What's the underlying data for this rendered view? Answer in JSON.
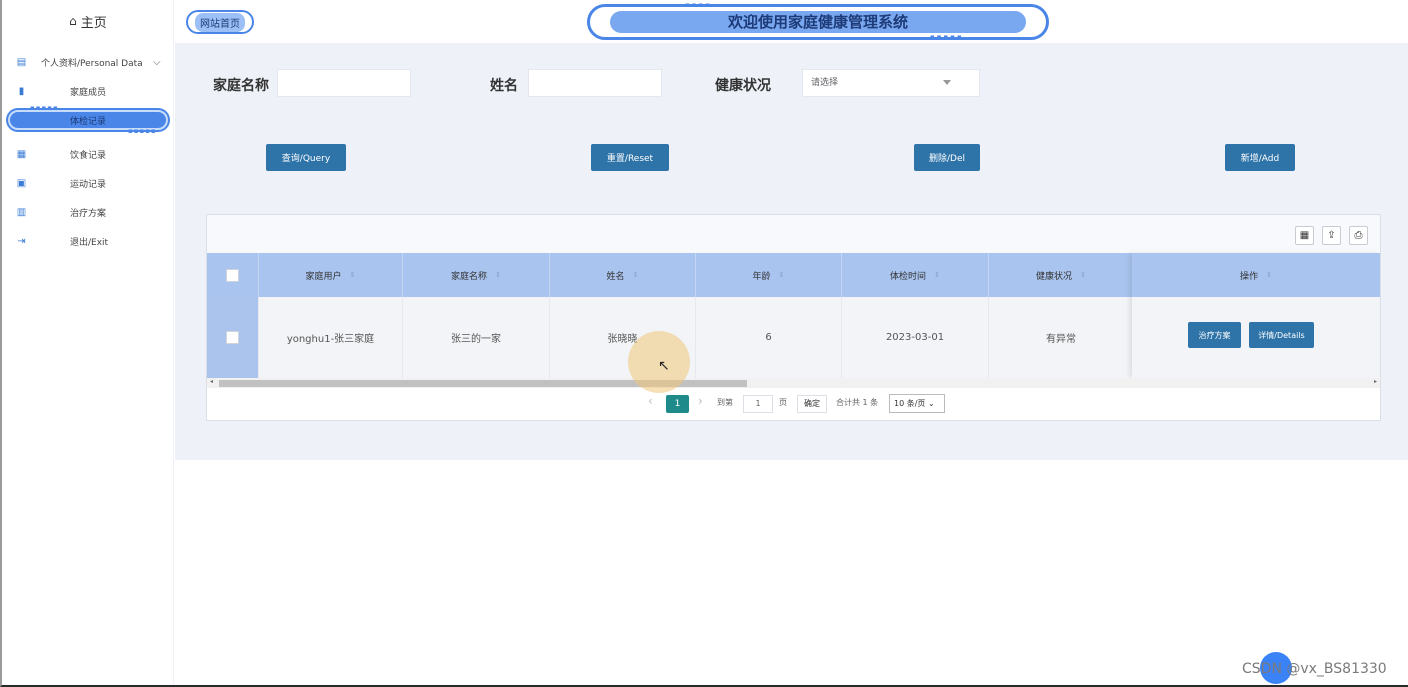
{
  "sidebar": {
    "home": "主页",
    "group": "个人资料/Personal Data",
    "items": [
      {
        "label": "家庭成员",
        "icon": "bookmark-icon"
      },
      {
        "label": "体检记录",
        "icon": "document-icon"
      },
      {
        "label": "饮食记录",
        "icon": "calendar-icon"
      },
      {
        "label": "运动记录",
        "icon": "calendar-check-icon"
      },
      {
        "label": "治疗方案",
        "icon": "book-icon"
      },
      {
        "label": "退出/Exit",
        "icon": "logout-icon"
      }
    ]
  },
  "header": {
    "home_link": "网站首页",
    "title": "欢迎使用家庭健康管理系统"
  },
  "search": {
    "family_name_label": "家庭名称",
    "family_name_value": "",
    "name_label": "姓名",
    "name_value": "",
    "health_label": "健康状况",
    "health_placeholder": "请选择"
  },
  "actions": {
    "query": "查询/Query",
    "reset": "重置/Reset",
    "delete": "删除/Del",
    "add": "新增/Add"
  },
  "table": {
    "columns": [
      "家庭用户",
      "家庭名称",
      "姓名",
      "年龄",
      "体检时间",
      "健康状况",
      "操作"
    ],
    "rows": [
      {
        "family_user": "yonghu1-张三家庭",
        "family_name": "张三的一家",
        "name": "张晓晓",
        "age": "6",
        "exam_time": "2023-03-01",
        "health": "有异常",
        "actions": [
          "治疗方案",
          "详情/Details"
        ]
      }
    ]
  },
  "pagination": {
    "current": "1",
    "goto_label": "到第",
    "goto_value": "1",
    "page_suffix": "页",
    "confirm": "确定",
    "total": "合计共 1 条",
    "page_size": "10 条/页"
  },
  "watermark": "CSDN @vx_BS81330"
}
